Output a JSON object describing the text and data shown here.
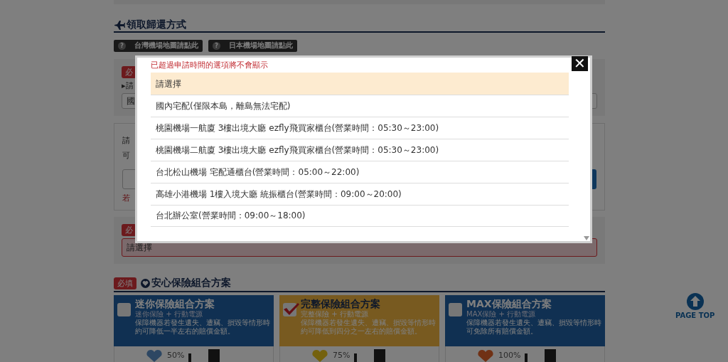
{
  "pickup_section": {
    "title": "領取歸還方式",
    "map_buttons": [
      {
        "icon": "?",
        "label": "台灣機場地圖請點此"
      },
      {
        "icon": "?",
        "label": "日本機場地圖請點此"
      }
    ]
  },
  "panels": [
    {
      "kind": "select",
      "badge": "必",
      "bullet": "▸",
      "label": "請",
      "value": "國"
    },
    {
      "kind": "input",
      "lines": [
        "請",
        "可"
      ],
      "note": "若"
    },
    {
      "kind": "select",
      "badge": "必",
      "value": "請選擇",
      "invalid": true
    }
  ],
  "insurance": {
    "badge": "必填",
    "title": "安心保險組合方案",
    "plans": [
      {
        "name": "迷你保險組合方案",
        "subtitle": "迷你保險 + 行動電源",
        "description": "保障機器若發生遺失、遭竊、損毀等情形時約可降低一半左右的賠償金額。",
        "checked": false,
        "percent": "50%"
      },
      {
        "name": "完整保險組合方案",
        "subtitle": "完整保險 + 行動電源",
        "description": "保障機器若發生遺失、遭竊、損毀等情形時約可降低到四分之一左右的賠償金額。",
        "checked": true,
        "percent": "75%"
      },
      {
        "name": "MAX保險組合方案",
        "subtitle": "MAX保險 + 行動電源",
        "description": "保障機器若發生遺失、遭竊、損毀等情形時可免除所有賠償金額。",
        "checked": false,
        "percent": "100%"
      }
    ]
  },
  "page_top": "PAGE TOP",
  "modal": {
    "close": "✕",
    "note": "已超過申請時間的選項將不會顯示",
    "options": [
      {
        "label": "請選擇",
        "selected": true
      },
      {
        "label": "國內宅配(僅限本島，離島無法宅配)",
        "selected": false
      },
      {
        "label": "桃園機場一航廈 3樓出境大廳 ezfly飛買家櫃台(營業時間：05:30～23:00)",
        "selected": false
      },
      {
        "label": "桃園機場二航廈 3樓出境大廳 ezfly飛買家櫃台(營業時間：05:30～23:00)",
        "selected": false
      },
      {
        "label": "台北松山機場 宅配通櫃台(營業時間：05:00～22:00)",
        "selected": false
      },
      {
        "label": "高雄小港機場 1樓入境大廳 統振櫃台(營業時間：09:00～20:00)",
        "selected": false
      },
      {
        "label": "台北辦公室(營業時間：09:00～18:00)",
        "selected": false
      }
    ]
  }
}
